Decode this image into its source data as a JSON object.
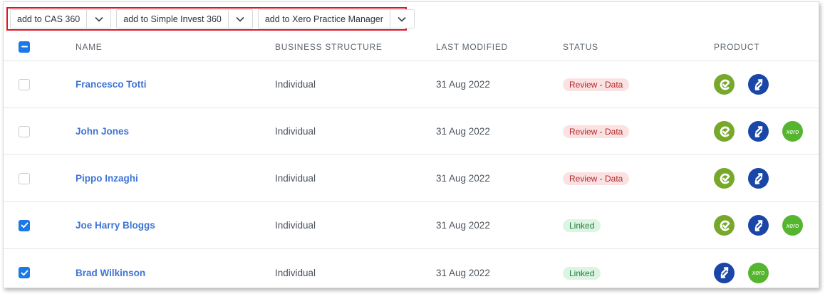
{
  "toolbar": {
    "buttons": [
      {
        "label": "add to CAS 360"
      },
      {
        "label": "add to Simple Invest 360"
      },
      {
        "label": "add to Xero Practice Manager"
      }
    ]
  },
  "table": {
    "headers": {
      "name": "NAME",
      "structure": "BUSINESS STRUCTURE",
      "modified": "LAST MODIFIED",
      "status": "STATUS",
      "product": "PRODUCT"
    },
    "rows": [
      {
        "name": "Francesco Totti",
        "structure": "Individual",
        "modified": "31 Aug 2022",
        "status": "Review - Data",
        "checked": false,
        "products": [
          "cas-360",
          "simple-invest-360"
        ]
      },
      {
        "name": "John Jones",
        "structure": "Individual",
        "modified": "31 Aug 2022",
        "status": "Review - Data",
        "checked": false,
        "products": [
          "cas-360",
          "simple-invest-360",
          "xero"
        ]
      },
      {
        "name": "Pippo Inzaghi",
        "structure": "Individual",
        "modified": "31 Aug 2022",
        "status": "Review - Data",
        "checked": false,
        "products": [
          "cas-360",
          "simple-invest-360"
        ]
      },
      {
        "name": "Joe Harry Bloggs",
        "structure": "Individual",
        "modified": "31 Aug 2022",
        "status": "Linked",
        "checked": true,
        "products": [
          "cas-360",
          "simple-invest-360",
          "xero"
        ]
      },
      {
        "name": "Brad Wilkinson",
        "structure": "Individual",
        "modified": "31 Aug 2022",
        "status": "Linked",
        "checked": true,
        "products": [
          "simple-invest-360",
          "xero"
        ]
      }
    ]
  },
  "icons": {
    "xero_text": "xero"
  },
  "colors": {
    "accent": "#1b78e8",
    "link": "#3d74d6",
    "highlight": "#e0161e",
    "cas": "#77a82b",
    "simple_invest": "#1a46a8",
    "xero": "#55b52f",
    "review_bg": "#fbe2e2",
    "linked_bg": "#dcf5e3"
  }
}
